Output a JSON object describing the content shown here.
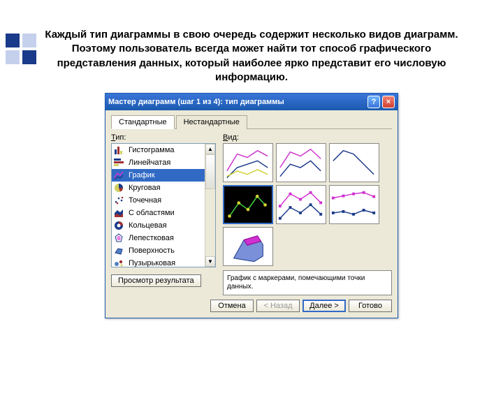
{
  "caption": "Каждый тип диаграммы в свою очередь содержит несколько видов диаграмм. Поэтому пользователь всегда может найти тот способ графического представления данных, который наиболее ярко представит его числовую информацию.",
  "window": {
    "title": "Мастер диаграмм (шаг 1 из 4): тип диаграммы"
  },
  "tabs": {
    "standard": "Стандартные",
    "custom": "Нестандартные"
  },
  "labels": {
    "type": "Тип:",
    "type_u": "Т",
    "view": "Вид:",
    "view_u": "В"
  },
  "types": {
    "items": [
      {
        "icon": "histogram",
        "label": "Гистограмма"
      },
      {
        "icon": "bar",
        "label": "Линейчатая"
      },
      {
        "icon": "line",
        "label": "График"
      },
      {
        "icon": "pie",
        "label": "Круговая"
      },
      {
        "icon": "scatter",
        "label": "Точечная"
      },
      {
        "icon": "area",
        "label": "С областями"
      },
      {
        "icon": "donut",
        "label": "Кольцевая"
      },
      {
        "icon": "radar",
        "label": "Лепестковая"
      },
      {
        "icon": "surface",
        "label": "Поверхность"
      },
      {
        "icon": "bubble",
        "label": "Пузырьковая"
      }
    ]
  },
  "description": "График с маркерами, помечающими точки данных.",
  "buttons": {
    "preview": "Просмотр результата",
    "cancel": "Отмена",
    "back": "< Назад",
    "next": "Далее >",
    "finish": "Готово"
  }
}
